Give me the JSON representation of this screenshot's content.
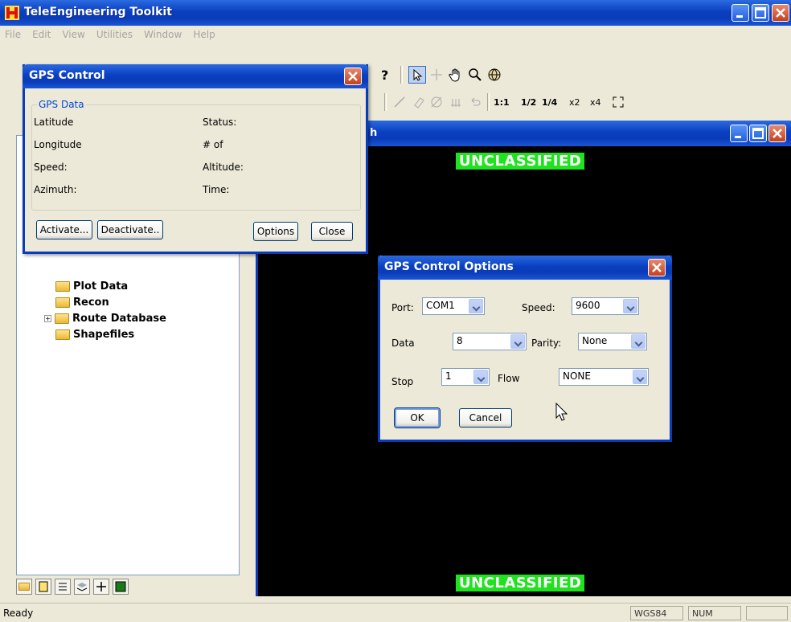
{
  "app": {
    "title": "TeleEngineering Toolkit"
  },
  "menu": [
    "File",
    "Edit",
    "View",
    "Utilities",
    "Window",
    "Help"
  ],
  "toolbar": {
    "zoom_labels": [
      "1:1",
      "1/2",
      "1/4",
      "x2",
      "x4"
    ]
  },
  "tree": {
    "items": [
      {
        "label": "Plot Data",
        "expandable": false
      },
      {
        "label": "Recon",
        "expandable": false
      },
      {
        "label": "Route Database",
        "expandable": true
      },
      {
        "label": "Shapefiles",
        "expandable": false
      }
    ]
  },
  "map": {
    "title_fragment": "h",
    "banner_top": "UNCLASSIFIED",
    "banner_bottom": "UNCLASSIFIED"
  },
  "gps_control": {
    "title": "GPS Control",
    "group_label": "GPS Data",
    "fields_left": [
      "Latitude",
      "Longitude",
      "Speed:",
      "Azimuth:"
    ],
    "fields_right": [
      "Status:",
      "# of",
      "Altitude:",
      "Time:"
    ],
    "buttons": {
      "activate": "Activate...",
      "deactivate": "Deactivate..",
      "options": "Options",
      "close": "Close"
    }
  },
  "gps_options": {
    "title": "GPS Control Options",
    "port_label": "Port:",
    "port_value": "COM1",
    "speed_label": "Speed:",
    "speed_value": "9600",
    "data_label": "Data",
    "data_value": "8",
    "parity_label": "Parity:",
    "parity_value": "None",
    "stop_label": "Stop",
    "stop_value": "1",
    "flow_label": "Flow",
    "flow_value": "NONE",
    "ok": "OK",
    "cancel": "Cancel"
  },
  "status": {
    "text": "Ready",
    "datum": "WGS84",
    "num": "NUM"
  },
  "colors": {
    "titlebar": "#0a3bb8",
    "banner": "#1ee31e",
    "map_bg": "#000000"
  }
}
